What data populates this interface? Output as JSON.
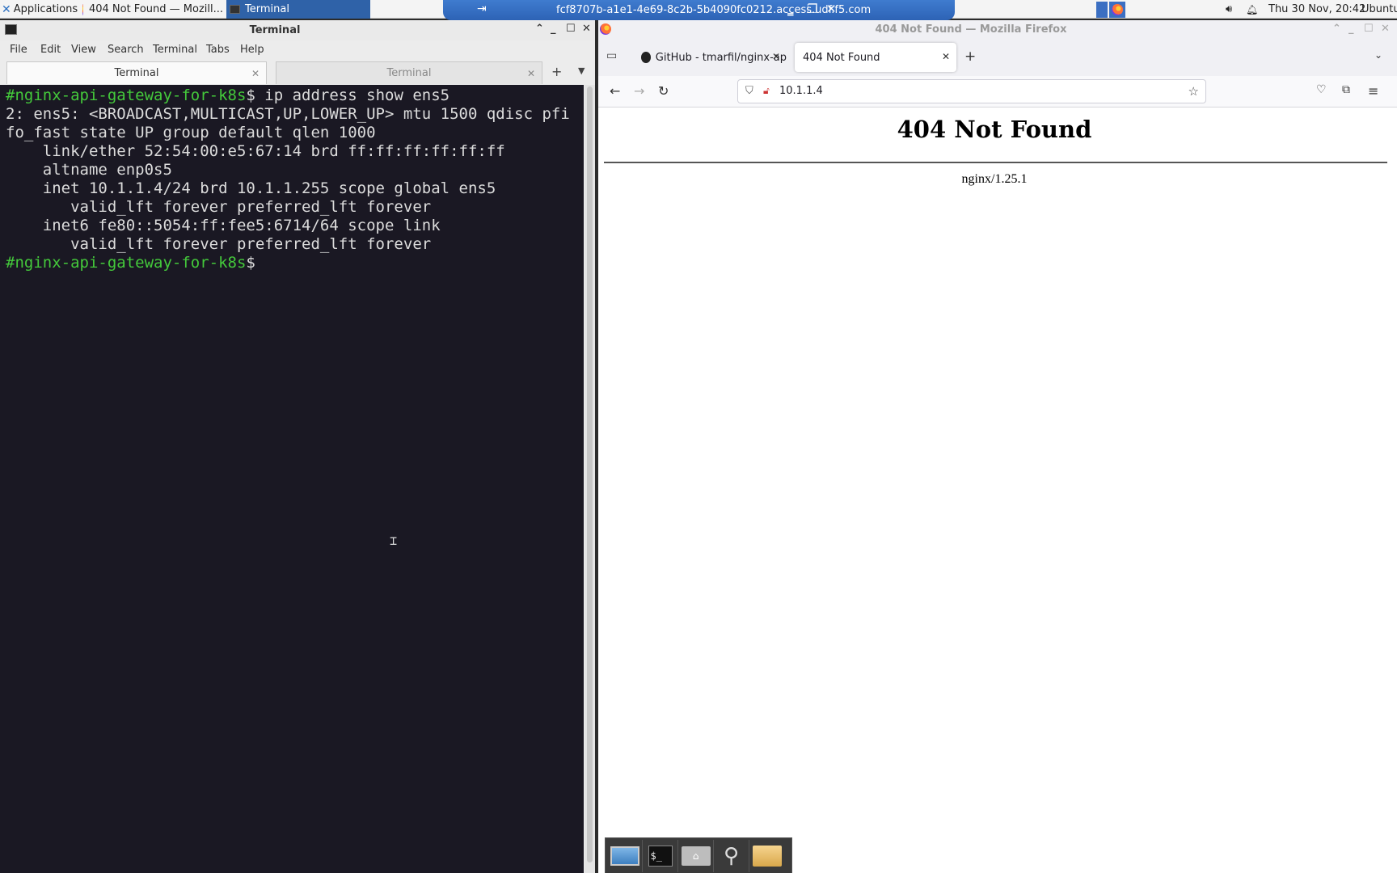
{
  "top_panel": {
    "applications_label": "Applications",
    "task_firefox": "404 Not Found — Mozill...",
    "task_terminal": "Terminal",
    "remote_host": "fcf8707b-a1e1-4e69-8c2b-5b4090fc0212.access.udf.f5.com",
    "clock": "Thu 30 Nov, 20:42",
    "user": "Ubuntu"
  },
  "terminal": {
    "window_title": "Terminal",
    "menu": [
      "File",
      "Edit",
      "View",
      "Search",
      "Terminal",
      "Tabs",
      "Help"
    ],
    "tabs": [
      {
        "label": "Terminal",
        "active": true
      },
      {
        "label": "Terminal",
        "active": false
      }
    ],
    "lines": [
      {
        "prompt": "#nginx-api-gateway-for-k8s",
        "text": "$ ip address show ens5"
      },
      {
        "prompt": "",
        "text": "2: ens5: <BROADCAST,MULTICAST,UP,LOWER_UP> mtu 1500 qdisc pfi"
      },
      {
        "prompt": "",
        "text": "fo_fast state UP group default qlen 1000"
      },
      {
        "prompt": "",
        "text": "    link/ether 52:54:00:e5:67:14 brd ff:ff:ff:ff:ff:ff"
      },
      {
        "prompt": "",
        "text": "    altname enp0s5"
      },
      {
        "prompt": "",
        "text": "    inet 10.1.1.4/24 brd 10.1.1.255 scope global ens5"
      },
      {
        "prompt": "",
        "text": "       valid_lft forever preferred_lft forever"
      },
      {
        "prompt": "",
        "text": "    inet6 fe80::5054:ff:fee5:6714/64 scope link"
      },
      {
        "prompt": "",
        "text": "       valid_lft forever preferred_lft forever"
      },
      {
        "prompt": "#nginx-api-gateway-for-k8s",
        "text": "$"
      }
    ],
    "prompt_color": "#44c93b",
    "background": "#1a1823"
  },
  "firefox": {
    "window_title": "404 Not Found — Mozilla Firefox",
    "tabs": [
      {
        "label": "GitHub - tmarfil/nginx-ap",
        "active": false
      },
      {
        "label": "404 Not Found",
        "active": true
      }
    ],
    "url": "10.1.1.4",
    "page": {
      "heading": "404 Not Found",
      "server": "nginx/1.25.1"
    }
  },
  "dock": {
    "items": [
      "desktop-icon",
      "terminal-icon",
      "home-folder-icon",
      "search-icon",
      "folder-icon"
    ],
    "terminal_glyph": "$_"
  }
}
